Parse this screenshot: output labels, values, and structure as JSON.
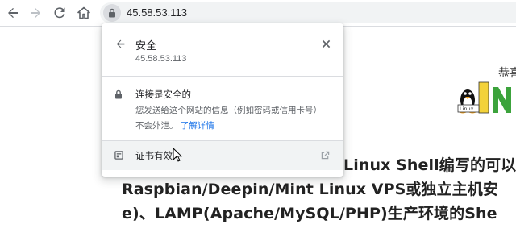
{
  "browser": {
    "url": "45.58.53.113"
  },
  "popup": {
    "title": "安全",
    "host": "45.58.53.113",
    "connection": {
      "title": "连接是安全的",
      "description": "您发送给这个网站的信息（例如密码或信用卡号）不会外泄。",
      "link": "了解详情"
    },
    "certificate": {
      "label": "证书有效"
    }
  },
  "page": {
    "greeting": "恭喜",
    "logo_text": "Linux",
    "headline_1": "Linux Shell编写的可以",
    "headline_2": "Raspbian/Deepin/Mint Linux VPS或独立主机安",
    "headline_3": "e)、LAMP(Apache/MySQL/PHP)生产环境的She"
  },
  "colors": {
    "link": "#1a73e8",
    "logo_green": "#3ca33c",
    "chip_gray": "#dadce0"
  },
  "icons": {
    "back": "back-arrow-icon",
    "forward": "forward-arrow-icon",
    "reload": "reload-icon",
    "home": "home-icon",
    "lock": "lock-icon",
    "close": "close-icon",
    "certificate": "certificate-icon",
    "external": "external-link-icon"
  }
}
